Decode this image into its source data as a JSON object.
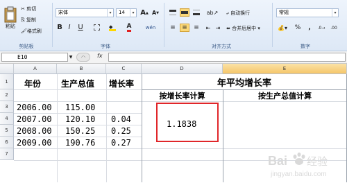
{
  "ribbon": {
    "clipboard": {
      "paste": "粘贴",
      "cut": "剪切",
      "copy": "复制",
      "format_painter": "格式刷",
      "label": "剪贴板"
    },
    "font": {
      "name": "宋体",
      "size": "14",
      "grow": "A",
      "shrink": "A",
      "bold": "B",
      "italic": "I",
      "underline": "U",
      "phonetic": "wén",
      "label": "字体"
    },
    "alignment": {
      "wrap_text": "自动换行",
      "merge_center": "合并后居中",
      "label": "对齐方式"
    },
    "number": {
      "format": "常规",
      "percent": "%",
      "comma": ",",
      "label": "数字"
    }
  },
  "formula_bar": {
    "name_box": "E10",
    "fx": "fx",
    "formula": ""
  },
  "sheet": {
    "columns": [
      "A",
      "B",
      "C",
      "D",
      "E"
    ],
    "rows": [
      "1",
      "2",
      "3",
      "4",
      "5",
      "6",
      "7"
    ],
    "headers": {
      "year": "年份",
      "gdp": "生产总值",
      "rate": "增长率"
    },
    "merged_title": "年平均增长率",
    "sub_headers": {
      "by_rate": "按增长率计算",
      "by_total": "按生产总值计算"
    },
    "data": [
      {
        "year": "2006.00",
        "gdp": "115.00",
        "rate": ""
      },
      {
        "year": "2007.00",
        "gdp": "120.10",
        "rate": "0.04"
      },
      {
        "year": "2008.00",
        "gdp": "150.25",
        "rate": "0.25"
      },
      {
        "year": "2009.00",
        "gdp": "190.76",
        "rate": "0.27"
      }
    ],
    "result": "1.1838"
  },
  "watermark": {
    "brand": "Bai",
    "suffix": "经验",
    "url": "jingyan.baidu.com"
  },
  "colors": {
    "highlight_red": "#e0262a",
    "ribbon_blue": "#dde8f6"
  }
}
